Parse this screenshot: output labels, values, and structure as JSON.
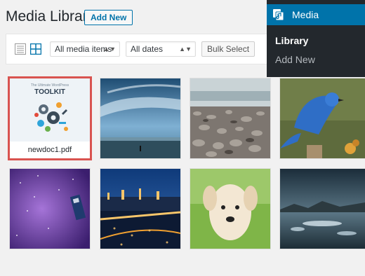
{
  "header": {
    "title": "Media Library",
    "add_new_label": "Add New"
  },
  "toolbar": {
    "media_type_filter": "All media items",
    "date_filter": "All dates",
    "bulk_select_label": "Bulk Select",
    "view_list_icon": "list-view-icon",
    "view_grid_icon": "grid-view-icon"
  },
  "attachments": [
    {
      "kind": "pdf",
      "filename": "newdoc1.pdf",
      "selected": true,
      "thumb_title": "TOOLKIT",
      "thumb_subtitle": "The Ultimate WordPress"
    },
    {
      "kind": "image",
      "subject": "beach-sky",
      "selected": false
    },
    {
      "kind": "image",
      "subject": "pebbles-shore",
      "selected": false
    },
    {
      "kind": "image",
      "subject": "bluebird",
      "selected": false
    },
    {
      "kind": "image",
      "subject": "purple-space",
      "selected": false
    },
    {
      "kind": "image",
      "subject": "city-bridge-night",
      "selected": false
    },
    {
      "kind": "image",
      "subject": "puppy",
      "selected": false
    },
    {
      "kind": "image",
      "subject": "lake-storm",
      "selected": false
    }
  ],
  "admin_menu": {
    "section_label": "Media",
    "section_icon": "media-icon",
    "items": [
      {
        "label": "Library",
        "current": true
      },
      {
        "label": "Add New",
        "current": false
      }
    ]
  },
  "colors": {
    "accent": "#0073aa",
    "selected_border": "#d9534f",
    "menu_bg": "#23282d"
  }
}
